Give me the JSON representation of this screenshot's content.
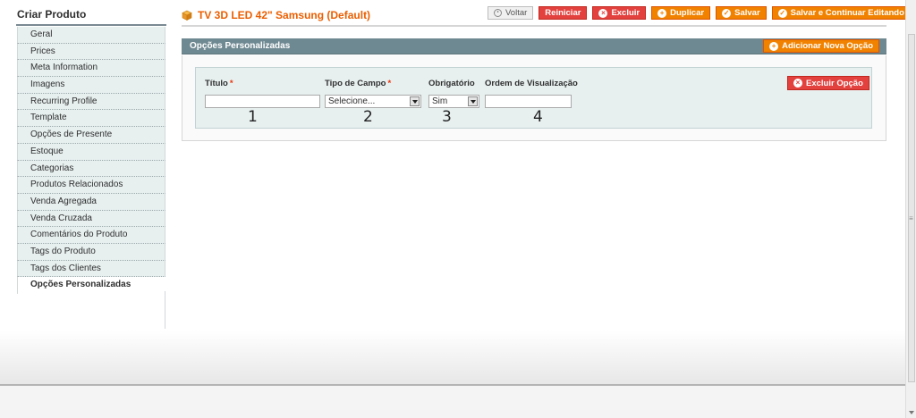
{
  "sidebar": {
    "title": "Criar Produto",
    "items": [
      {
        "label": "Geral"
      },
      {
        "label": "Prices"
      },
      {
        "label": "Meta Information"
      },
      {
        "label": "Imagens"
      },
      {
        "label": "Recurring Profile"
      },
      {
        "label": "Template"
      },
      {
        "label": "Opções de Presente"
      },
      {
        "label": "Estoque"
      },
      {
        "label": "Categorias"
      },
      {
        "label": "Produtos Relacionados"
      },
      {
        "label": "Venda Agregada"
      },
      {
        "label": "Venda Cruzada"
      },
      {
        "label": "Comentários do Produto"
      },
      {
        "label": "Tags do Produto"
      },
      {
        "label": "Tags dos Clientes"
      },
      {
        "label": "Opções Personalizadas"
      }
    ],
    "active_item": "Opções Personalizadas"
  },
  "header": {
    "title": "TV 3D LED 42\" Samsung (Default)",
    "title_icon": "cube-icon",
    "buttons": {
      "back": "Voltar",
      "reset": "Reiniciar",
      "delete": "Excluir",
      "duplicate": "Duplicar",
      "save": "Salvar",
      "save_continue": "Salvar e Continuar Editando"
    }
  },
  "section": {
    "title": "Opções Personalizadas",
    "add_button": "Adicionar Nova Opção"
  },
  "option": {
    "delete_button": "Excluir Opção",
    "title_label": "Título",
    "type_label": "Tipo de Campo",
    "required_label": "Obrigatório",
    "sort_label": "Ordem de Visualização",
    "required_marker": "*",
    "title_value": "",
    "type_value": "Selecione...",
    "required_value": "Sim",
    "sort_value": ""
  },
  "annotations": [
    "1",
    "2",
    "3",
    "4"
  ],
  "colors": {
    "accent_orange": "#f18200",
    "title_orange": "#eb5e00",
    "delete_red": "#e2413e",
    "section_header": "#6f8992",
    "sidebar_item_bg": "#e7efef",
    "option_box_bg": "#e7efef"
  }
}
